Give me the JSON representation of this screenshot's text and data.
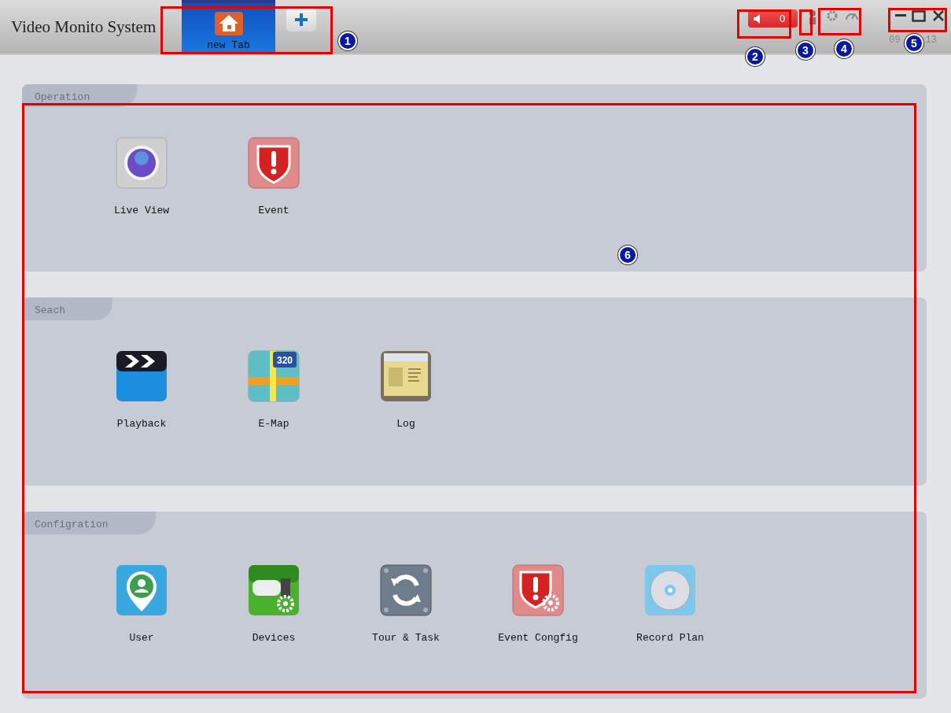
{
  "window": {
    "title": "Video Monito System"
  },
  "tabs": [
    {
      "label": "new Tab",
      "selected": true
    }
  ],
  "alarm": {
    "count": "0"
  },
  "clock": [
    "09",
    "13"
  ],
  "sections": [
    {
      "title": "Operation",
      "items": [
        {
          "kind": "camera",
          "label": "Live View"
        },
        {
          "kind": "alert",
          "label": "Event"
        }
      ]
    },
    {
      "title": "Seach",
      "items": [
        {
          "kind": "playback",
          "label": "Playback"
        },
        {
          "kind": "map",
          "label": "E-Map",
          "badge": "320"
        },
        {
          "kind": "log",
          "label": "Log"
        }
      ]
    },
    {
      "title": "Configration",
      "items": [
        {
          "kind": "user",
          "label": "User"
        },
        {
          "kind": "devices",
          "label": "Devices"
        },
        {
          "kind": "sync",
          "label": "Tour & Task"
        },
        {
          "kind": "alert-gear",
          "label": "Event Congfig"
        },
        {
          "kind": "disc",
          "label": "Record Plan"
        }
      ]
    }
  ],
  "callouts": [
    "1",
    "2",
    "3",
    "4",
    "5",
    "6"
  ]
}
